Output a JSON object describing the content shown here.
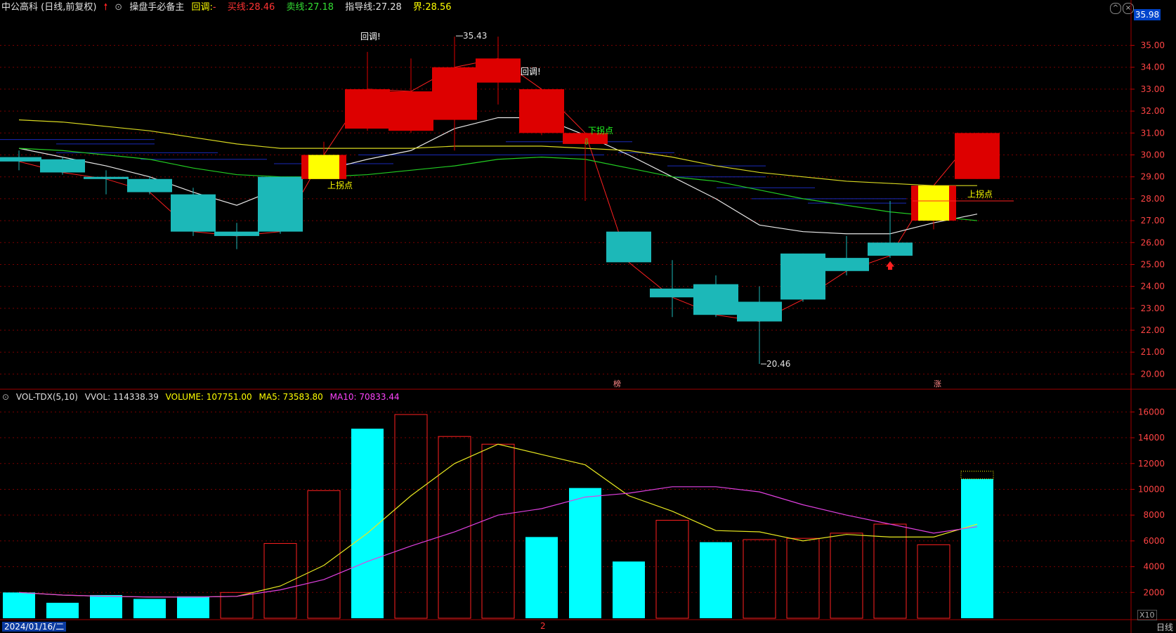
{
  "header": {
    "stock": "中公高科 (日线,前复权)",
    "indicator_name": "操盘手必备主",
    "huitiao_label": "回调:",
    "huitiao_value": "-",
    "buy_label": "买线:",
    "buy_value": "28.46",
    "sell_label": "卖线:",
    "sell_value": "27.18",
    "guide_label": "指导线:",
    "guide_value": "27.28",
    "jie_label": "界:",
    "jie_value": "28.56",
    "current_price": "35.98"
  },
  "vol_header": {
    "name": "VOL-TDX(5,10)",
    "vvol": "VVOL: 114338.39",
    "volume": "VOLUME: 107751.00",
    "ma5": "MA5: 73583.80",
    "ma10": "MA10: 70833.44"
  },
  "footer": {
    "date": "2024/01/16/二",
    "mid_marker": "2",
    "period": "日线",
    "x10": "X10"
  },
  "annotations": {
    "high": "35.43",
    "low": "20.46",
    "huitiao1": "回调!",
    "huitiao2": "回调!",
    "up_turn1": "上拐点",
    "up_turn2": "上拐点",
    "down_turn": "下拐点",
    "bang": "榜",
    "zhang": "涨"
  },
  "colors": {
    "up": "#dd0000",
    "down": "#1cb8b8",
    "yellow": "#ffff00",
    "vol_down": "#00ffff",
    "ma5": "#e8e820",
    "ma10": "#e040e0",
    "grid": "#7a0000"
  },
  "chart_data": [
    {
      "type": "candlestick",
      "title": "中公高科 (日线,前复权)",
      "y_ticks": [
        "35.00",
        "34.00",
        "33.00",
        "32.00",
        "31.00",
        "30.00",
        "29.00",
        "28.00",
        "27.00",
        "26.00",
        "25.00",
        "24.00",
        "23.00",
        "22.00",
        "21.00",
        "20.00"
      ],
      "ylim": [
        19.5,
        36.3
      ],
      "candles": [
        {
          "o": 29.9,
          "c": 29.7,
          "h": 30.2,
          "l": 29.3,
          "hl": 0
        },
        {
          "o": 29.8,
          "c": 29.2,
          "h": 29.9,
          "l": 29.1,
          "hl": 0
        },
        {
          "o": 29.0,
          "c": 28.9,
          "h": 29.3,
          "l": 28.2,
          "hl": 0
        },
        {
          "o": 28.9,
          "c": 28.3,
          "h": 29.0,
          "l": 28.2,
          "hl": 0
        },
        {
          "o": 28.2,
          "c": 26.5,
          "h": 28.5,
          "l": 26.3,
          "hl": 0
        },
        {
          "o": 26.5,
          "c": 26.3,
          "h": 26.9,
          "l": 25.7,
          "hl": 0
        },
        {
          "o": 29.0,
          "c": 26.5,
          "h": 29.0,
          "l": 26.4,
          "hl": 0
        },
        {
          "o": 28.9,
          "c": 30.0,
          "h": 30.6,
          "l": 29.5,
          "hl": 1
        },
        {
          "o": 31.2,
          "c": 33.0,
          "h": 34.7,
          "l": 31.1,
          "hl": 0
        },
        {
          "o": 31.1,
          "c": 32.9,
          "h": 34.4,
          "l": 31.0,
          "hl": 0
        },
        {
          "o": 31.6,
          "c": 34.0,
          "h": 35.4,
          "l": 30.2,
          "hl": 0
        },
        {
          "o": 33.3,
          "c": 34.4,
          "h": 35.4,
          "l": 32.3,
          "hl": 0
        },
        {
          "o": 31.0,
          "c": 33.0,
          "h": 33.0,
          "l": 30.9,
          "hl": 0
        },
        {
          "o": 30.5,
          "c": 31.0,
          "h": 30.5,
          "l": 27.9,
          "hl": 0
        },
        {
          "o": 26.5,
          "c": 25.1,
          "h": 26.5,
          "l": 25.1,
          "hl": 0
        },
        {
          "o": 23.9,
          "c": 23.5,
          "h": 25.2,
          "l": 22.6,
          "hl": 0
        },
        {
          "o": 24.1,
          "c": 22.7,
          "h": 24.5,
          "l": 22.6,
          "hl": 0
        },
        {
          "o": 23.3,
          "c": 22.4,
          "h": 24.0,
          "l": 20.46,
          "hl": 0
        },
        {
          "o": 25.5,
          "c": 23.4,
          "h": 25.5,
          "l": 23.3,
          "hl": 0
        },
        {
          "o": 25.3,
          "c": 24.7,
          "h": 26.3,
          "l": 24.5,
          "hl": 0
        },
        {
          "o": 26.0,
          "c": 25.4,
          "h": 27.9,
          "l": 25.3,
          "hl": 0
        },
        {
          "o": 27.0,
          "c": 28.6,
          "h": 28.6,
          "l": 26.6,
          "hl": 1
        },
        {
          "o": 28.9,
          "c": 31.0,
          "h": 31.0,
          "l": 28.9,
          "hl": 0
        }
      ],
      "lines": {
        "white": [
          30.3,
          29.9,
          29.5,
          29.0,
          28.3,
          27.7,
          28.5,
          29.3,
          29.8,
          30.2,
          31.2,
          31.7,
          31.7,
          30.9,
          30.0,
          29.0,
          28.0,
          26.8,
          26.5,
          26.4,
          26.4,
          26.9,
          27.3
        ],
        "green": [
          30.3,
          30.2,
          30.0,
          29.8,
          29.4,
          29.1,
          29.0,
          29.0,
          29.1,
          29.3,
          29.5,
          29.8,
          29.9,
          29.8,
          29.4,
          29.0,
          28.8,
          28.4,
          28.0,
          27.7,
          27.4,
          27.2,
          27.0
        ],
        "yellow": [
          31.6,
          31.5,
          31.3,
          31.1,
          30.8,
          30.5,
          30.3,
          30.3,
          30.3,
          30.3,
          30.4,
          30.4,
          30.4,
          30.3,
          30.2,
          29.9,
          29.5,
          29.2,
          29.0,
          28.8,
          28.7,
          28.6,
          28.6
        ]
      }
    },
    {
      "type": "bar",
      "title": "VOL-TDX(5,10)",
      "y_ticks": [
        "16000",
        "14000",
        "12000",
        "10000",
        "8000",
        "6000",
        "4000",
        "2000"
      ],
      "ylim": [
        0,
        17000
      ],
      "volumes": [
        2000,
        1200,
        1800,
        1500,
        1700,
        2000,
        5800,
        9900,
        14700,
        15800,
        14100,
        13500,
        6300,
        10100,
        4400,
        7600,
        5900,
        6100,
        6200,
        6600,
        7300,
        5700,
        10800
      ],
      "up": [
        0,
        0,
        0,
        0,
        0,
        1,
        1,
        1,
        0,
        1,
        1,
        1,
        0,
        0,
        0,
        1,
        0,
        1,
        1,
        1,
        1,
        1,
        0
      ],
      "ma5": [
        2000,
        1800,
        1700,
        1650,
        1640,
        1700,
        2500,
        4100,
        6600,
        9500,
        12000,
        13500,
        12700,
        11900,
        9500,
        8300,
        6800,
        6700,
        6000,
        6500,
        6300,
        6300,
        7300
      ],
      "ma10": [
        2000,
        1800,
        1700,
        1650,
        1640,
        1700,
        2200,
        3000,
        4400,
        5600,
        6700,
        8000,
        8500,
        9400,
        9700,
        10200,
        10200,
        9800,
        8800,
        8000,
        7300,
        6600,
        7100
      ]
    }
  ]
}
